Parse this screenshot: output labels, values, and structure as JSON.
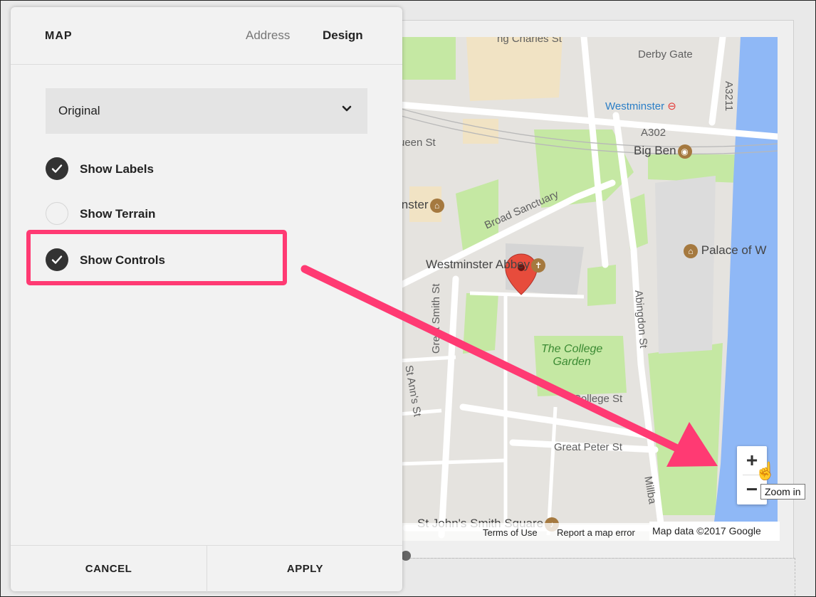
{
  "panel": {
    "title": "MAP",
    "tabs": [
      {
        "label": "Address",
        "active": false
      },
      {
        "label": "Design",
        "active": true
      }
    ],
    "style_select": {
      "value": "Original"
    },
    "options": [
      {
        "label": "Show Labels",
        "checked": true
      },
      {
        "label": "Show Terrain",
        "checked": false
      },
      {
        "label": "Show Controls",
        "checked": true
      }
    ],
    "footer": {
      "cancel_label": "CANCEL",
      "apply_label": "APPLY"
    }
  },
  "map": {
    "labels": {
      "charles_st": "ng Charles St",
      "derby_gate": "Derby Gate",
      "westminster_station": "Westminster",
      "a3211": "A3211",
      "queen_st": "ueen St",
      "a302": "A302",
      "big_ben": "Big Ben",
      "westminster_partial": "inster",
      "broad_sanctuary": "Broad Sanctuary",
      "palace": "Palace of W",
      "westminster_abbey": "Westminster Abbey",
      "great_smith_st": "Great Smith St",
      "abingdon_st": "Abingdon St",
      "college_garden_1": "The College",
      "college_garden_2": "Garden",
      "college_st": "College St",
      "st_anns_st": "St Ann's St",
      "great_peter_st": "Great Peter St",
      "millbank": "Millba",
      "st_johns": "St John's Smith Square"
    },
    "attribution": {
      "terms": "Terms of Use",
      "report": "Report a map error",
      "data": "Map data ©2017 Google"
    },
    "zoom": {
      "in_symbol": "+",
      "out_symbol": "−",
      "tooltip": "Zoom in"
    }
  },
  "colors": {
    "accent_highlight": "#ff3a73",
    "checkbox_on": "#333333",
    "water": "#8fb8f6",
    "park": "#c5e8a3",
    "marker": "#e74c3c"
  }
}
